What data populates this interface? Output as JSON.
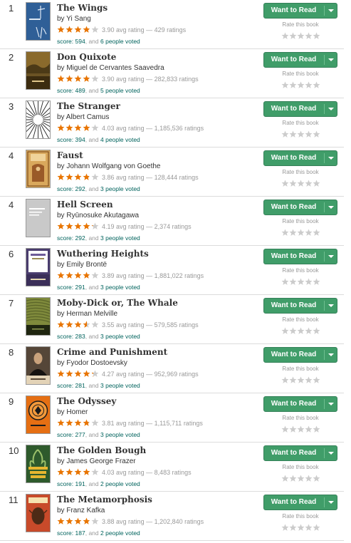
{
  "button": {
    "want_to_read": "Want to Read"
  },
  "rate_label": "Rate this book",
  "labels": {
    "avg": "avg rating",
    "ratings": "ratings",
    "score": "score:",
    "and": ", and ",
    "by": "by "
  },
  "colors": {
    "star_filled": "#e87400",
    "star_empty": "#cccccc",
    "button_green": "#409d69",
    "link": "#00635d"
  },
  "books": [
    {
      "rank": "1",
      "title": "The Wings",
      "author": "Yi Sang",
      "rating": 3.9,
      "rating_text": "3.90",
      "ratings": "429",
      "score": "594",
      "votes": "6 people voted",
      "cover": {
        "bg": "#2f5f97",
        "fg": "#dde7f3",
        "kind": "wings"
      }
    },
    {
      "rank": "2",
      "title": "Don Quixote",
      "author": "Miguel de Cervantes Saavedra",
      "rating": 3.9,
      "rating_text": "3.90",
      "ratings": "282,833",
      "score": "489",
      "votes": "5 people voted",
      "cover": {
        "bg": "#6b5324",
        "fg": "#e0c68a",
        "kind": "painting"
      }
    },
    {
      "rank": "3",
      "title": "The Stranger",
      "author": "Albert Camus",
      "rating": 4.03,
      "rating_text": "4.03",
      "ratings": "1,185,536",
      "score": "394",
      "votes": "4 people voted",
      "cover": {
        "bg": "#ffffff",
        "fg": "#222222",
        "kind": "burst"
      }
    },
    {
      "rank": "4",
      "title": "Faust",
      "author": "Johann Wolfgang von Goethe",
      "rating": 3.86,
      "rating_text": "3.86",
      "ratings": "128,444",
      "score": "292",
      "votes": "3 people voted",
      "cover": {
        "bg": "#d9a85c",
        "fg": "#6a3c14",
        "kind": "faust"
      }
    },
    {
      "rank": "4",
      "title": "Hell Screen",
      "author": "Ryūnosuke Akutagawa",
      "rating": 4.19,
      "rating_text": "4.19",
      "ratings": "2,374",
      "score": "292",
      "votes": "3 people voted",
      "cover": {
        "bg": "#c9c9c9",
        "fg": "#ffffff",
        "kind": "plain"
      }
    },
    {
      "rank": "6",
      "title": "Wuthering Heights",
      "author": "Emily Brontë",
      "rating": 3.89,
      "rating_text": "3.89",
      "ratings": "1,881,022",
      "score": "291",
      "votes": "3 people voted",
      "cover": {
        "bg": "#4a3d6e",
        "fg": "#e4d7b0",
        "kind": "classic"
      }
    },
    {
      "rank": "7",
      "title": "Moby-Dick or, The Whale",
      "author": "Herman Melville",
      "rating": 3.55,
      "rating_text": "3.55",
      "ratings": "579,585",
      "score": "283",
      "votes": "3 people voted",
      "cover": {
        "bg": "#7f8a3c",
        "fg": "#1f2610",
        "kind": "moby"
      }
    },
    {
      "rank": "8",
      "title": "Crime and Punishment",
      "author": "Fyodor Dostoevsky",
      "rating": 4.27,
      "rating_text": "4.27",
      "ratings": "952,969",
      "score": "281",
      "votes": "3 people voted",
      "cover": {
        "bg": "#3a3028",
        "fg": "#e3d3b7",
        "kind": "portrait"
      }
    },
    {
      "rank": "9",
      "title": "The Odyssey",
      "author": "Homer",
      "rating": 3.81,
      "rating_text": "3.81",
      "ratings": "1,115,711",
      "score": "277",
      "votes": "3 people voted",
      "cover": {
        "bg": "#e56f13",
        "fg": "#1b1b1b",
        "kind": "odyssey"
      }
    },
    {
      "rank": "10",
      "title": "The Golden Bough",
      "author": "James George Frazer",
      "rating": 4.03,
      "rating_text": "4.03",
      "ratings": "8,483",
      "score": "191",
      "votes": "2 people voted",
      "cover": {
        "bg": "#2e5a2c",
        "fg": "#e7b630",
        "kind": "bough"
      }
    },
    {
      "rank": "11",
      "title": "The Metamorphosis",
      "author": "Franz Kafka",
      "rating": 3.88,
      "rating_text": "3.88",
      "ratings": "1,202,840",
      "score": "187",
      "votes": "2 people voted",
      "cover": {
        "bg": "#c84a2a",
        "fg": "#f6e2b0",
        "kind": "kafka"
      }
    }
  ]
}
